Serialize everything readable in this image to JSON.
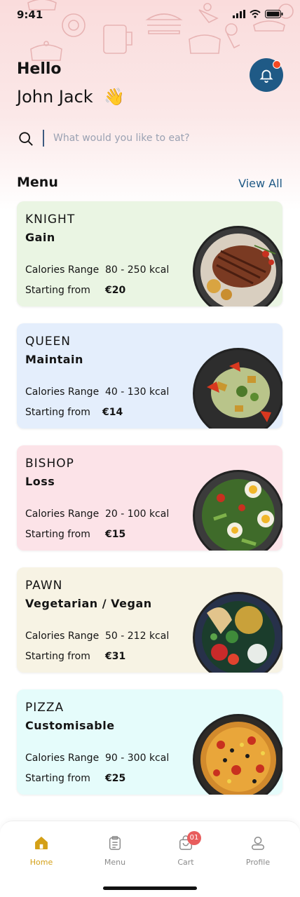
{
  "status_bar": {
    "time": "9:41"
  },
  "header": {
    "greeting": "Hello",
    "user_name": "John Jack",
    "wave_emoji": "👋"
  },
  "search": {
    "placeholder": "What would you like to eat?"
  },
  "menu_section": {
    "title": "Menu",
    "view_all_label": "View All"
  },
  "labels": {
    "calories_range": "Calories Range",
    "starting_from": "Starting from"
  },
  "menu_items": [
    {
      "tier": "KNIGHT",
      "goal": "Gain",
      "calories": "80 - 250 kcal",
      "price": "€20",
      "bg_color": "#eaf5e3"
    },
    {
      "tier": "QUEEN",
      "goal": "Maintain",
      "calories": "40 - 130 kcal",
      "price": "€14",
      "bg_color": "#e4eefc"
    },
    {
      "tier": "BISHOP",
      "goal": "Loss",
      "calories": "20 - 100 kcal",
      "price": "€15",
      "bg_color": "#fce3e8"
    },
    {
      "tier": "PAWN",
      "goal": "Vegetarian / Vegan",
      "calories": "50 - 212 kcal",
      "price": "€31",
      "bg_color": "#f7f3e4"
    },
    {
      "tier": "PIZZA",
      "goal": "Customisable",
      "calories": "90 - 300 kcal",
      "price": "€25",
      "bg_color": "#e5fcfb"
    }
  ],
  "tab_bar": {
    "items": [
      {
        "label": "Home",
        "icon": "home-icon",
        "active": true
      },
      {
        "label": "Menu",
        "icon": "clipboard-icon",
        "active": false
      },
      {
        "label": "Cart",
        "icon": "cart-icon",
        "active": false,
        "badge": "01"
      },
      {
        "label": "Profile",
        "icon": "profile-icon",
        "active": false
      }
    ]
  },
  "colors": {
    "accent": "#1f5a86",
    "active_tab": "#d4a017",
    "notification_dot": "#f24822",
    "badge": "#e85d5d"
  }
}
